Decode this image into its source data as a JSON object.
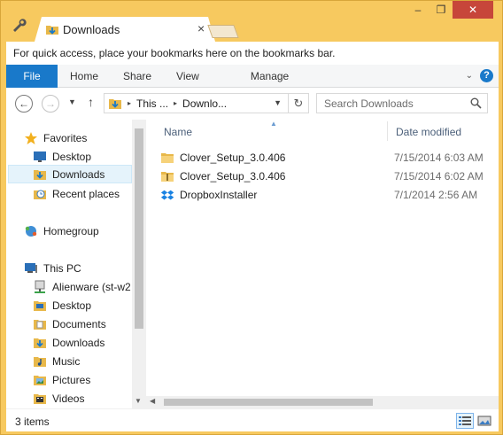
{
  "window": {
    "tab_title": "Downloads",
    "tab_close": "×",
    "controls": {
      "minimize": "–",
      "restore": "❐",
      "close": "✕"
    }
  },
  "bookmarks_bar": {
    "message": "For quick access, place your bookmarks here on the bookmarks bar."
  },
  "ribbon": {
    "tabs": [
      {
        "label": "File"
      },
      {
        "label": "Home"
      },
      {
        "label": "Share"
      },
      {
        "label": "View"
      },
      {
        "label": "Manage"
      }
    ],
    "help": "?",
    "expand": "⌄"
  },
  "address_bar": {
    "back": "←",
    "forward": "→",
    "history": "▼",
    "up": "↑",
    "crumbs": [
      "This ...",
      "Downlo..."
    ],
    "crumb_separator": "▸",
    "dropdown": "▼",
    "refresh": "↻",
    "search_placeholder": "Search Downloads"
  },
  "nav_pane": {
    "items": [
      {
        "label": "Favorites",
        "icon": "star-icon"
      },
      {
        "label": "Desktop",
        "icon": "desktop-icon"
      },
      {
        "label": "Downloads",
        "icon": "downloads-folder-icon",
        "selected": true
      },
      {
        "label": "Recent places",
        "icon": "recent-places-icon"
      },
      {
        "label": "Homegroup",
        "icon": "homegroup-icon"
      },
      {
        "label": "This PC",
        "icon": "computer-icon"
      },
      {
        "label": "Alienware (st-w2",
        "icon": "network-drive-icon"
      },
      {
        "label": "Desktop",
        "icon": "folder-icon"
      },
      {
        "label": "Documents",
        "icon": "folder-icon"
      },
      {
        "label": "Downloads",
        "icon": "downloads-folder-icon"
      },
      {
        "label": "Music",
        "icon": "music-folder-icon"
      },
      {
        "label": "Pictures",
        "icon": "pictures-folder-icon"
      },
      {
        "label": "Videos",
        "icon": "videos-folder-icon"
      }
    ]
  },
  "file_list": {
    "columns": {
      "name": "Name",
      "date_modified": "Date modified"
    },
    "sort_indicator": "▲",
    "rows": [
      {
        "name": "Clover_Setup_3.0.406",
        "date": "7/15/2014 6:03 AM",
        "icon": "folder-icon"
      },
      {
        "name": "Clover_Setup_3.0.406",
        "date": "7/15/2014 6:02 AM",
        "icon": "zip-folder-icon"
      },
      {
        "name": "DropboxInstaller",
        "date": "7/1/2014 2:56 AM",
        "icon": "dropbox-icon"
      }
    ]
  },
  "status_bar": {
    "item_count": "3 items"
  },
  "colors": {
    "accent": "#1979ca",
    "frame": "#f7c95f",
    "selection": "#e5f3fb"
  }
}
